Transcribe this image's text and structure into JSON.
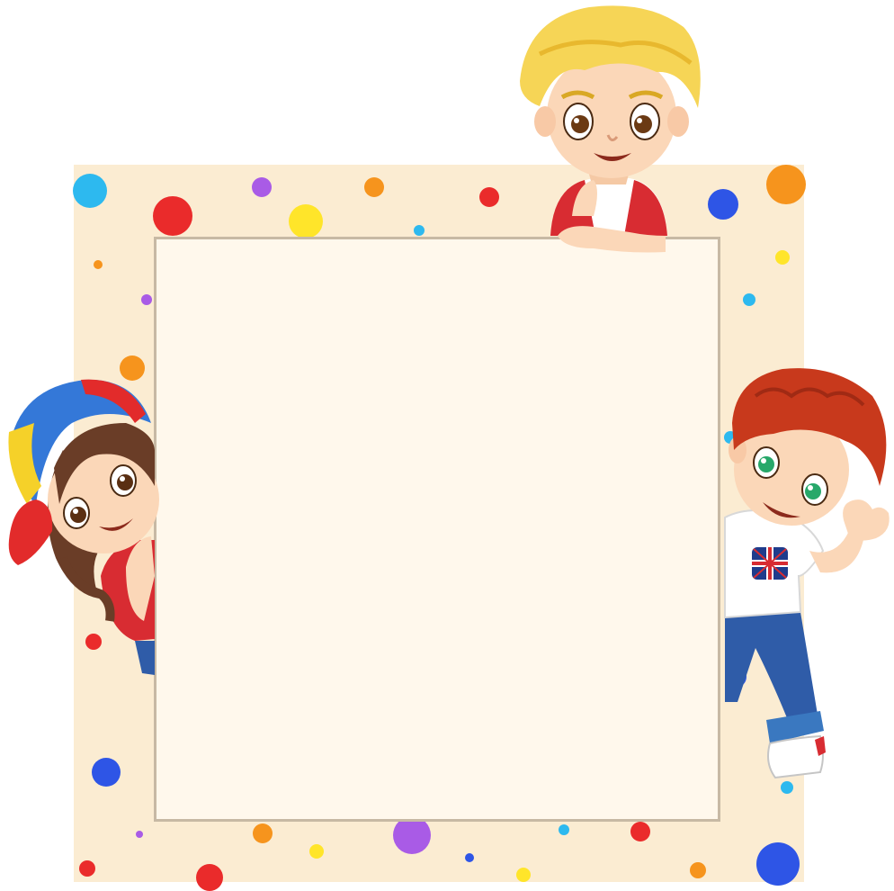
{
  "colors": {
    "background": "#ffffff",
    "backdrop": "#fbecd2",
    "panel_fill": "#fff8ec",
    "panel_border": "#c7b9a4",
    "dot_red": "#ea2b2b",
    "dot_blue": "#2e55e6",
    "dot_cyan": "#2db9ef",
    "dot_yellow": "#ffe52a",
    "dot_orange": "#f6941d",
    "dot_purple": "#a95be6",
    "blond_hair": "#f6d556",
    "red_hair": "#c8391c",
    "brown_hair": "#6a3d27",
    "skin": "#fbd7b8",
    "shirt_red": "#d82c32",
    "shirt_white": "#ffffff",
    "jeans": "#2f5ca8",
    "cap_blue": "#3478d8",
    "cap_yellow": "#f5d129",
    "cap_red": "#e22b2b"
  },
  "characters": {
    "top": "blond-boy",
    "left": "girl-with-cap",
    "right": "redhead-boy"
  },
  "panel": {
    "text": ""
  }
}
